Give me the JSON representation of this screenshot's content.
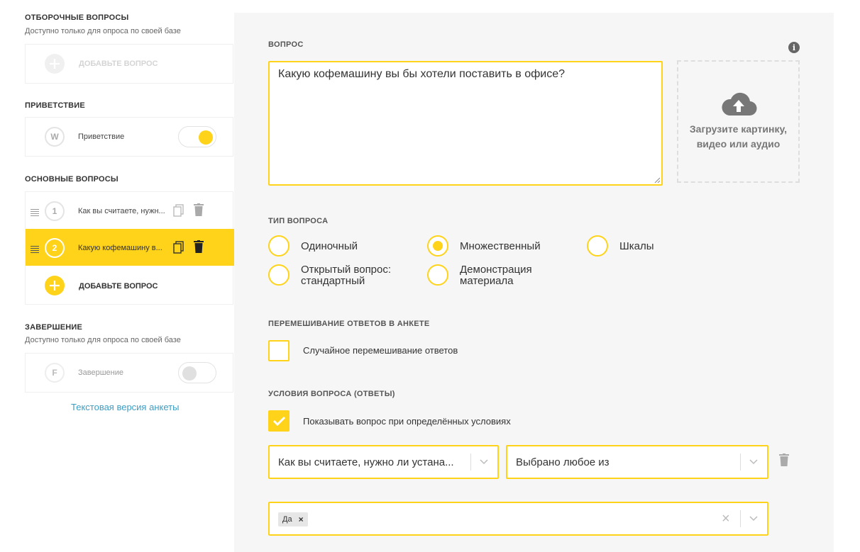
{
  "sidebar": {
    "screening": {
      "title": "ОТБОРОЧНЫЕ ВОПРОСЫ",
      "subtitle": "Доступно только для опроса по своей базе",
      "add_label": "ДОБАВЬТЕ ВОПРОС"
    },
    "greeting": {
      "title": "ПРИВЕТСТВИЕ",
      "letter": "W",
      "label": "Приветствие",
      "enabled": true
    },
    "main": {
      "title": "ОСНОВНЫЕ ВОПРОСЫ",
      "questions": [
        {
          "number": "1",
          "label": "Как вы считаете, нужн..."
        },
        {
          "number": "2",
          "label": "Какую кофемашину в..."
        }
      ],
      "add_label": "ДОБАВЬТЕ ВОПРОС"
    },
    "ending": {
      "title": "ЗАВЕРШЕНИЕ",
      "subtitle": "Доступно только для опроса по своей базе",
      "letter": "F",
      "label": "Завершение",
      "enabled": false
    },
    "text_version_link": "Текстовая версия анкеты"
  },
  "panel": {
    "question_label": "ВОПРОС",
    "question_text": "Какую кофемашину вы бы хотели поставить в офисе?",
    "upload_text_line1": "Загрузите картинку,",
    "upload_text_line2": "видео или аудио",
    "info_glyph": "i",
    "type_label": "ТИП ВОПРОСА",
    "types": [
      {
        "label": "Одиночный",
        "selected": false
      },
      {
        "label": "Множественный",
        "selected": true
      },
      {
        "label": "Шкалы",
        "selected": false
      },
      {
        "label_line1": "Открытый вопрос:",
        "label_line2": "стандартный",
        "selected": false
      },
      {
        "label_line1": "Демонстрация",
        "label_line2": "материала",
        "selected": false
      }
    ],
    "shuffle_label": "ПЕРЕМЕШИВАНИЕ ОТВЕТОВ В АНКЕТЕ",
    "shuffle_checkbox": {
      "label": "Случайное перемешивание ответов",
      "checked": false
    },
    "conditions_label": "УСЛОВИЯ ВОПРОСА (ОТВЕТЫ)",
    "conditions_checkbox": {
      "label": "Показывать вопрос при определённых условиях",
      "checked": true
    },
    "condition_question": "Как вы считаете, нужно ли устана...",
    "condition_operator": "Выбрано любое из",
    "condition_tags": [
      {
        "label": "Да",
        "remove": "×"
      }
    ],
    "clear_glyph": "×"
  },
  "colors": {
    "accent": "#ffd31a",
    "panel_bg": "#f6f6f6",
    "link": "#3d9ec4"
  }
}
